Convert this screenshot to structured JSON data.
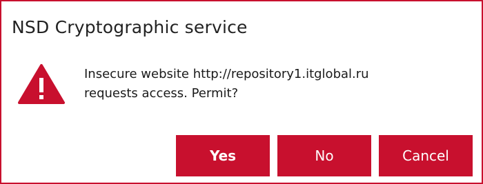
{
  "dialog": {
    "title": "NSD Cryptographic service",
    "icon": "warning-icon",
    "message_line1": "Insecure website http://repository1.itglobal.ru",
    "message_line2": "requests access. Permit?",
    "buttons": {
      "yes": "Yes",
      "no": "No",
      "cancel": "Cancel"
    }
  },
  "colors": {
    "accent": "#c8102e",
    "text": "#1a1a1a",
    "button_text": "#ffffff"
  }
}
